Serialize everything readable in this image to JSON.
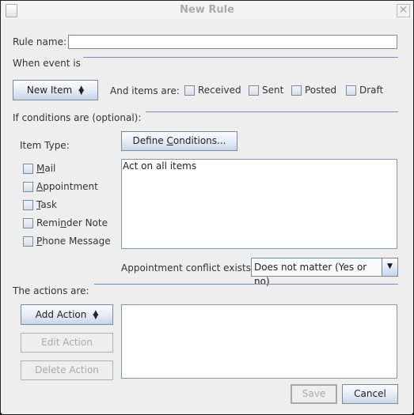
{
  "window": {
    "title": "New Rule",
    "close_label": "✕"
  },
  "rule_name": {
    "label": "Rule name:",
    "value": ""
  },
  "when_event": {
    "heading": "When event is",
    "event_button": "New Item",
    "items_are_label": "And items are:",
    "checkboxes": [
      {
        "label": "Received",
        "checked": false
      },
      {
        "label": "Sent",
        "checked": false
      },
      {
        "label": "Posted",
        "checked": false
      },
      {
        "label": "Draft",
        "checked": false
      }
    ]
  },
  "conditions": {
    "heading": "If conditions are  (optional):",
    "item_type_label": "Item Type:",
    "define_button_prefix": "Define ",
    "define_button_mnemonic": "C",
    "define_button_suffix": "onditions...",
    "item_types": [
      {
        "pre": "",
        "mn": "M",
        "post": "ail",
        "checked": false
      },
      {
        "pre": "",
        "mn": "A",
        "post": "ppointment",
        "checked": false
      },
      {
        "pre": "",
        "mn": "T",
        "post": "ask",
        "checked": false
      },
      {
        "pre": "Remi",
        "mn": "n",
        "post": "der Note",
        "checked": false
      },
      {
        "pre": "",
        "mn": "P",
        "post": "hone Message",
        "checked": false
      }
    ],
    "conditions_text": "Act on all items",
    "conflict_label": "Appointment conflict exists:",
    "conflict_value": "Does not matter (Yes or no)"
  },
  "actions": {
    "heading": "The actions are:",
    "add_button": "Add Action",
    "edit_button": "Edit Action",
    "delete_button": "Delete Action"
  },
  "footer": {
    "save_button": "Save",
    "cancel_button": "Cancel"
  }
}
